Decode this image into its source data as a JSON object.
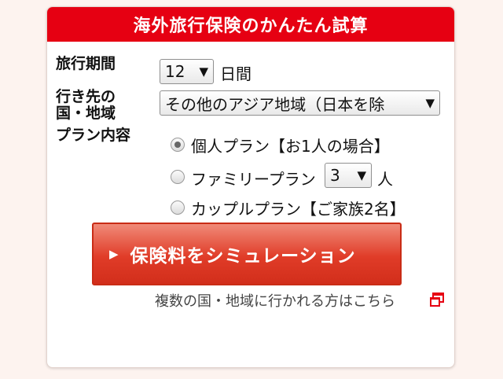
{
  "header": {
    "title": "海外旅行保険のかんたん試算"
  },
  "form": {
    "period": {
      "label": "旅行期間",
      "value": "12",
      "unit": "日間"
    },
    "destination": {
      "label_line1": "行き先の",
      "label_line2": "国・地域",
      "value": "その他のアジア地域（日本を除"
    },
    "plan": {
      "label": "プラン内容",
      "options": [
        {
          "label": "個人プラン【お1人の場合】",
          "checked": true
        },
        {
          "label": "ファミリープラン",
          "count_value": "3",
          "count_unit": "人",
          "checked": false
        },
        {
          "label": "カップルプラン【ご家族2名】",
          "checked": false
        }
      ]
    }
  },
  "simulate_button": {
    "label": "保険料をシミュレーション"
  },
  "multi_link": {
    "label": "複数の国・地域に行かれる方はこちら",
    "icon": "external-window-icon"
  },
  "colors": {
    "header": "#e60012",
    "button": "#e03c28",
    "background": "#fdf3ef"
  },
  "arrow_glyph": "▼"
}
